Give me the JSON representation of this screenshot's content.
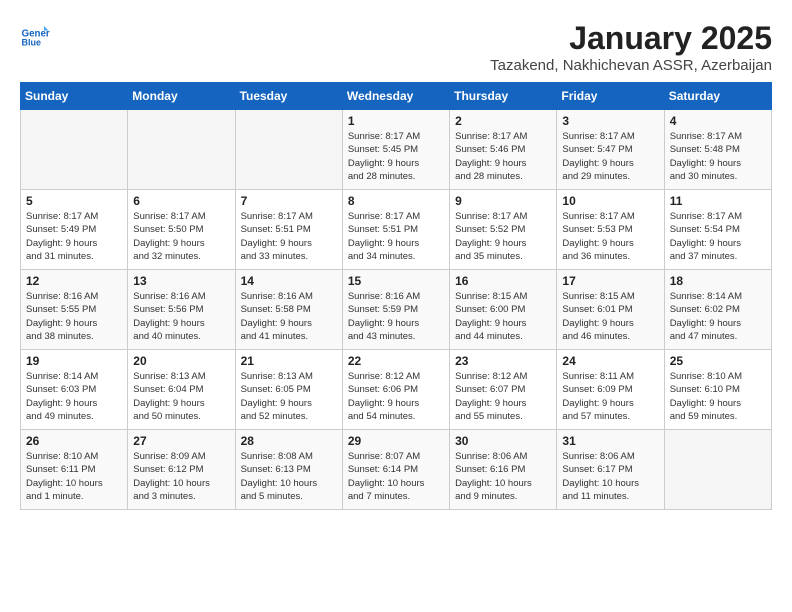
{
  "header": {
    "logo_line1": "General",
    "logo_line2": "Blue",
    "month": "January 2025",
    "location": "Tazakend, Nakhichevan ASSR, Azerbaijan"
  },
  "weekdays": [
    "Sunday",
    "Monday",
    "Tuesday",
    "Wednesday",
    "Thursday",
    "Friday",
    "Saturday"
  ],
  "weeks": [
    [
      {
        "day": "",
        "text": ""
      },
      {
        "day": "",
        "text": ""
      },
      {
        "day": "",
        "text": ""
      },
      {
        "day": "1",
        "text": "Sunrise: 8:17 AM\nSunset: 5:45 PM\nDaylight: 9 hours\nand 28 minutes."
      },
      {
        "day": "2",
        "text": "Sunrise: 8:17 AM\nSunset: 5:46 PM\nDaylight: 9 hours\nand 28 minutes."
      },
      {
        "day": "3",
        "text": "Sunrise: 8:17 AM\nSunset: 5:47 PM\nDaylight: 9 hours\nand 29 minutes."
      },
      {
        "day": "4",
        "text": "Sunrise: 8:17 AM\nSunset: 5:48 PM\nDaylight: 9 hours\nand 30 minutes."
      }
    ],
    [
      {
        "day": "5",
        "text": "Sunrise: 8:17 AM\nSunset: 5:49 PM\nDaylight: 9 hours\nand 31 minutes."
      },
      {
        "day": "6",
        "text": "Sunrise: 8:17 AM\nSunset: 5:50 PM\nDaylight: 9 hours\nand 32 minutes."
      },
      {
        "day": "7",
        "text": "Sunrise: 8:17 AM\nSunset: 5:51 PM\nDaylight: 9 hours\nand 33 minutes."
      },
      {
        "day": "8",
        "text": "Sunrise: 8:17 AM\nSunset: 5:51 PM\nDaylight: 9 hours\nand 34 minutes."
      },
      {
        "day": "9",
        "text": "Sunrise: 8:17 AM\nSunset: 5:52 PM\nDaylight: 9 hours\nand 35 minutes."
      },
      {
        "day": "10",
        "text": "Sunrise: 8:17 AM\nSunset: 5:53 PM\nDaylight: 9 hours\nand 36 minutes."
      },
      {
        "day": "11",
        "text": "Sunrise: 8:17 AM\nSunset: 5:54 PM\nDaylight: 9 hours\nand 37 minutes."
      }
    ],
    [
      {
        "day": "12",
        "text": "Sunrise: 8:16 AM\nSunset: 5:55 PM\nDaylight: 9 hours\nand 38 minutes."
      },
      {
        "day": "13",
        "text": "Sunrise: 8:16 AM\nSunset: 5:56 PM\nDaylight: 9 hours\nand 40 minutes."
      },
      {
        "day": "14",
        "text": "Sunrise: 8:16 AM\nSunset: 5:58 PM\nDaylight: 9 hours\nand 41 minutes."
      },
      {
        "day": "15",
        "text": "Sunrise: 8:16 AM\nSunset: 5:59 PM\nDaylight: 9 hours\nand 43 minutes."
      },
      {
        "day": "16",
        "text": "Sunrise: 8:15 AM\nSunset: 6:00 PM\nDaylight: 9 hours\nand 44 minutes."
      },
      {
        "day": "17",
        "text": "Sunrise: 8:15 AM\nSunset: 6:01 PM\nDaylight: 9 hours\nand 46 minutes."
      },
      {
        "day": "18",
        "text": "Sunrise: 8:14 AM\nSunset: 6:02 PM\nDaylight: 9 hours\nand 47 minutes."
      }
    ],
    [
      {
        "day": "19",
        "text": "Sunrise: 8:14 AM\nSunset: 6:03 PM\nDaylight: 9 hours\nand 49 minutes."
      },
      {
        "day": "20",
        "text": "Sunrise: 8:13 AM\nSunset: 6:04 PM\nDaylight: 9 hours\nand 50 minutes."
      },
      {
        "day": "21",
        "text": "Sunrise: 8:13 AM\nSunset: 6:05 PM\nDaylight: 9 hours\nand 52 minutes."
      },
      {
        "day": "22",
        "text": "Sunrise: 8:12 AM\nSunset: 6:06 PM\nDaylight: 9 hours\nand 54 minutes."
      },
      {
        "day": "23",
        "text": "Sunrise: 8:12 AM\nSunset: 6:07 PM\nDaylight: 9 hours\nand 55 minutes."
      },
      {
        "day": "24",
        "text": "Sunrise: 8:11 AM\nSunset: 6:09 PM\nDaylight: 9 hours\nand 57 minutes."
      },
      {
        "day": "25",
        "text": "Sunrise: 8:10 AM\nSunset: 6:10 PM\nDaylight: 9 hours\nand 59 minutes."
      }
    ],
    [
      {
        "day": "26",
        "text": "Sunrise: 8:10 AM\nSunset: 6:11 PM\nDaylight: 10 hours\nand 1 minute."
      },
      {
        "day": "27",
        "text": "Sunrise: 8:09 AM\nSunset: 6:12 PM\nDaylight: 10 hours\nand 3 minutes."
      },
      {
        "day": "28",
        "text": "Sunrise: 8:08 AM\nSunset: 6:13 PM\nDaylight: 10 hours\nand 5 minutes."
      },
      {
        "day": "29",
        "text": "Sunrise: 8:07 AM\nSunset: 6:14 PM\nDaylight: 10 hours\nand 7 minutes."
      },
      {
        "day": "30",
        "text": "Sunrise: 8:06 AM\nSunset: 6:16 PM\nDaylight: 10 hours\nand 9 minutes."
      },
      {
        "day": "31",
        "text": "Sunrise: 8:06 AM\nSunset: 6:17 PM\nDaylight: 10 hours\nand 11 minutes."
      },
      {
        "day": "",
        "text": ""
      }
    ]
  ]
}
